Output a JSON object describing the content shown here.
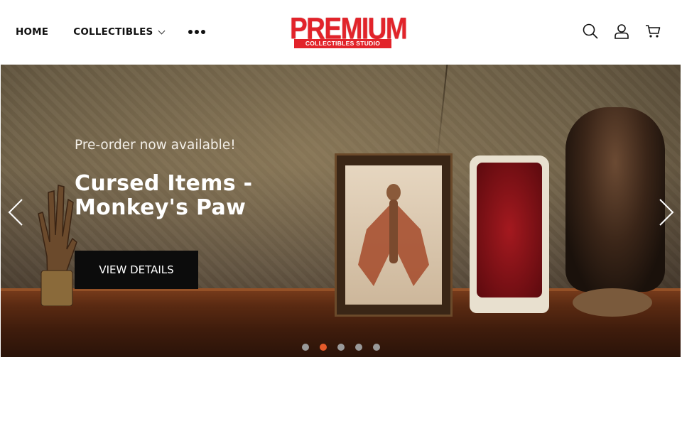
{
  "nav": {
    "home": "HOME",
    "collectibles": "COLLECTIBLES"
  },
  "logo": {
    "main": "PREMIUM",
    "sub": "COLLECTIBLES STUDIO",
    "color": "#e2232a"
  },
  "header_icons": [
    "search-icon",
    "account-icon",
    "cart-icon"
  ],
  "hero": {
    "preheading": "Pre-order now available!",
    "title": "Cursed Items - Monkey's Paw",
    "cta_label": "VIEW DETAILS",
    "slides_total": 5,
    "active_slide": 2,
    "indicator_active_color": "#e55a2a"
  }
}
